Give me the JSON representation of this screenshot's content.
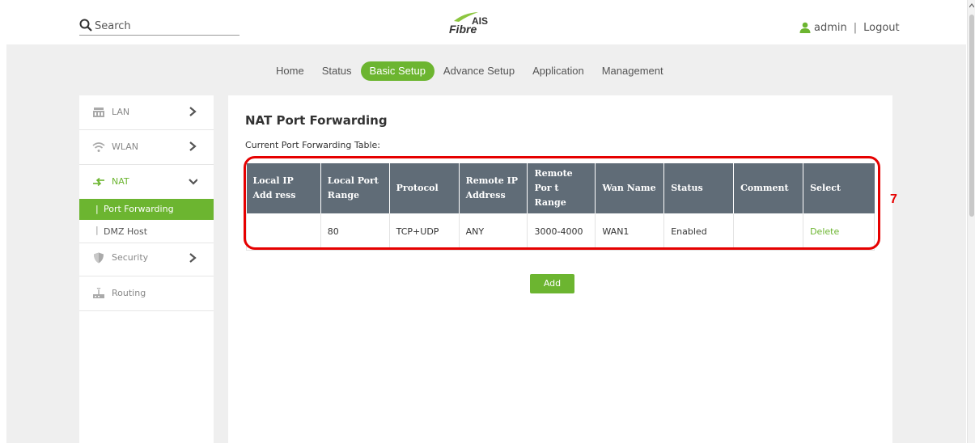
{
  "header": {
    "search_placeholder": "Search",
    "logo_top": "AIS",
    "logo_bottom": "Fibre",
    "user": "admin",
    "separator": "|",
    "logout": "Logout"
  },
  "nav": {
    "items": [
      "Home",
      "Status",
      "Basic Setup",
      "Advance Setup",
      "Application",
      "Management"
    ],
    "active": "Basic Setup"
  },
  "sidebar": {
    "lan": "LAN",
    "wlan": "WLAN",
    "nat": "NAT",
    "port_forwarding": "Port Forwarding",
    "dmz_host": "DMZ Host",
    "security": "Security",
    "routing": "Routing"
  },
  "content": {
    "title": "NAT Port Forwarding",
    "subtitle": "Current Port Forwarding Table:",
    "columns": [
      "Local IP Add ress",
      "Local Port Range",
      "Protocol",
      "Remote IP Address",
      "Remote Por t Range",
      "Wan Name",
      "Status",
      "Comment",
      "Select"
    ],
    "rows": [
      {
        "local_ip": "",
        "local_port_range": "80",
        "protocol": "TCP+UDP",
        "remote_ip": "ANY",
        "remote_port_range": "3000-4000",
        "wan_name": "WAN1",
        "status": "Enabled",
        "comment": "",
        "select": "Delete"
      }
    ],
    "add_label": "Add"
  },
  "annotation": {
    "number": "7"
  },
  "colors": {
    "accent": "#6cb530",
    "table_header": "#606c77",
    "annotation": "#e60000"
  }
}
